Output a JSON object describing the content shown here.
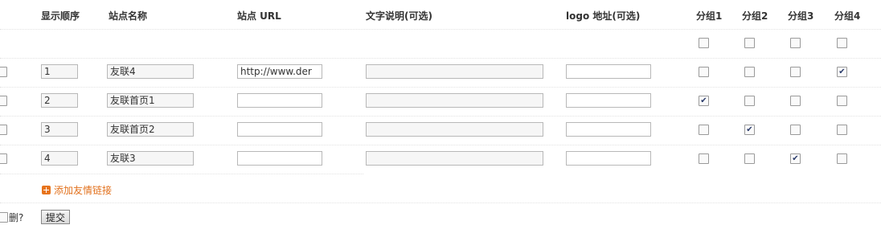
{
  "headers": {
    "order": "显示顺序",
    "name": "站点名称",
    "url": "站点 URL",
    "desc": "文字说明(可选)",
    "logo": "logo 地址(可选)",
    "group1": "分组1",
    "group2": "分组2",
    "group3": "分组3",
    "group4": "分组4"
  },
  "rows": [
    {
      "order": "1",
      "name": "友联4",
      "url": "http://www.der",
      "desc": "",
      "logo": "",
      "groups": [
        false,
        false,
        false,
        true
      ]
    },
    {
      "order": "2",
      "name": "友联首页1",
      "url": "",
      "desc": "",
      "logo": "",
      "groups": [
        true,
        false,
        false,
        false
      ]
    },
    {
      "order": "3",
      "name": "友联首页2",
      "url": "",
      "desc": "",
      "logo": "",
      "groups": [
        false,
        true,
        false,
        false
      ]
    },
    {
      "order": "4",
      "name": "友联3",
      "url": "",
      "desc": "",
      "logo": "",
      "groups": [
        false,
        false,
        true,
        false
      ]
    }
  ],
  "actions": {
    "add_link": "添加友情链接",
    "delete_label": "删?",
    "submit": "提交"
  },
  "colors": {
    "accent": "#e2711d",
    "checkmark": "#2a3b6b"
  },
  "icons": {
    "add": "plus-square-icon"
  }
}
